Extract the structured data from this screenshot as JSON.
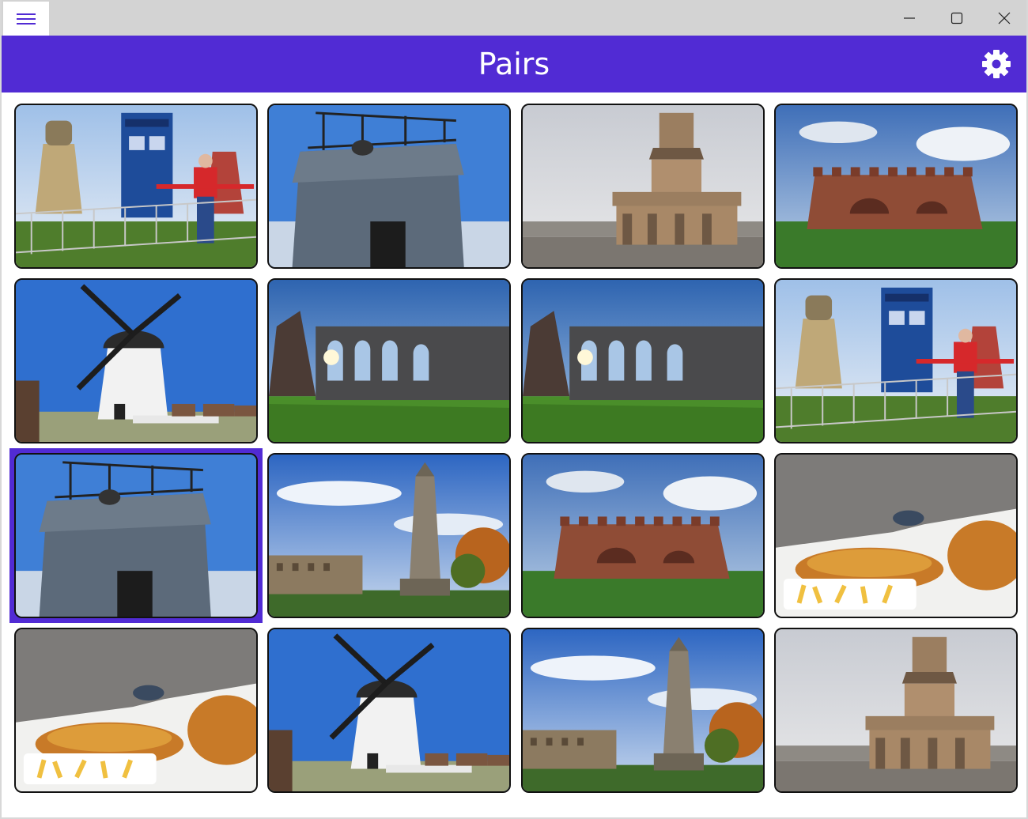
{
  "window": {
    "minimize_glyph": "—",
    "maximize_glyph": "☐",
    "close_glyph": "✕"
  },
  "header": {
    "title": "Pairs",
    "settings_icon": "gear-icon",
    "menu_icon": "hamburger-menu-icon",
    "background": "#512bd4"
  },
  "tiles": [
    {
      "image": "dalek-tardis-photo",
      "selected": false
    },
    {
      "image": "stone-tower-photo",
      "selected": false
    },
    {
      "image": "lighthouse-photo",
      "selected": false
    },
    {
      "image": "red-fort-photo",
      "selected": false
    },
    {
      "image": "windmill-photo",
      "selected": false
    },
    {
      "image": "abbey-ruins-photo",
      "selected": false
    },
    {
      "image": "abbey-ruins-photo",
      "selected": false
    },
    {
      "image": "dalek-tardis-photo",
      "selected": false
    },
    {
      "image": "stone-tower-photo",
      "selected": true
    },
    {
      "image": "obelisk-memorial-photo",
      "selected": false
    },
    {
      "image": "red-fort-photo",
      "selected": false
    },
    {
      "image": "fish-and-chips-photo",
      "selected": false
    },
    {
      "image": "fish-and-chips-photo",
      "selected": false
    },
    {
      "image": "windmill-photo",
      "selected": false
    },
    {
      "image": "obelisk-memorial-photo",
      "selected": false
    },
    {
      "image": "lighthouse-photo",
      "selected": false
    }
  ]
}
